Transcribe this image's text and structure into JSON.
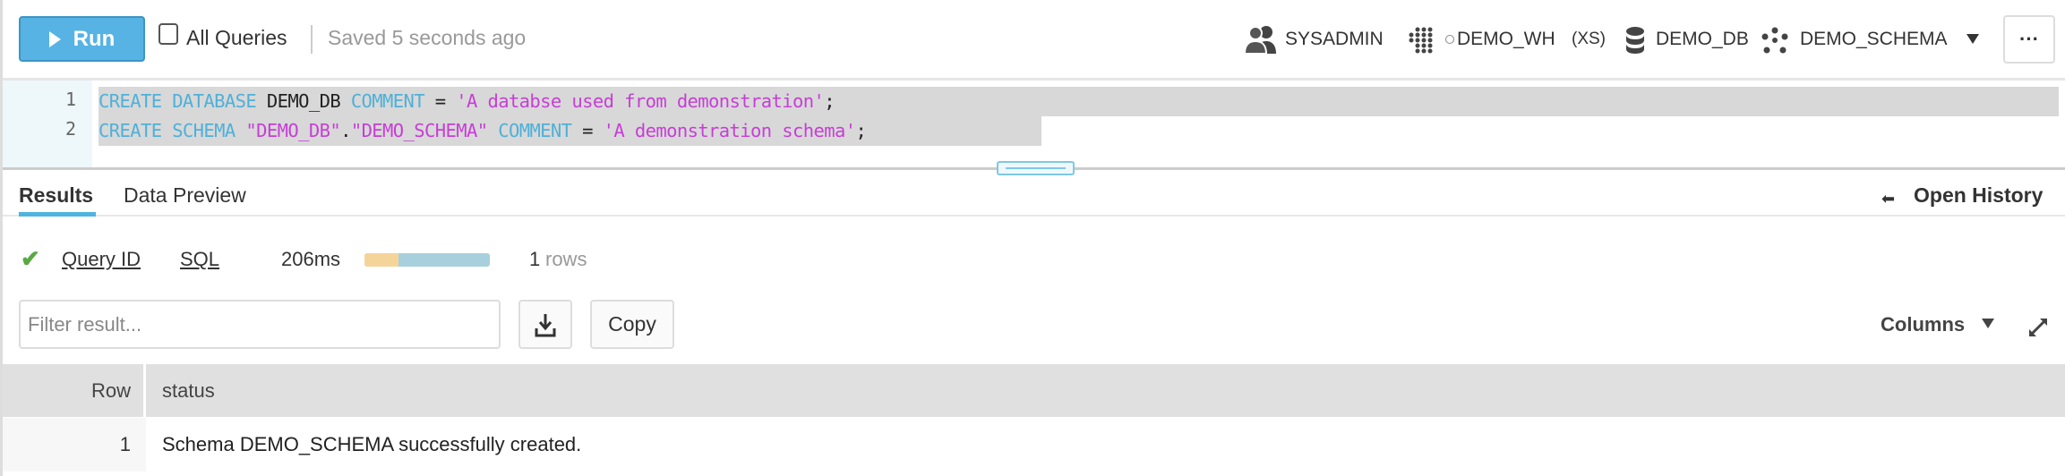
{
  "toolbar": {
    "run_label": "Run",
    "all_queries_label": "All Queries",
    "all_queries_checked": false,
    "saved_text": "Saved 5 seconds ago",
    "role": "SYSADMIN",
    "warehouse": "DEMO_WH",
    "warehouse_size": "(XS)",
    "database": "DEMO_DB",
    "schema": "DEMO_SCHEMA",
    "more_label": "···"
  },
  "editor": {
    "line_numbers": [
      "1",
      "2"
    ],
    "lines": [
      [
        {
          "t": "CREATE DATABASE ",
          "c": "kw"
        },
        {
          "t": "DEMO_DB ",
          "c": "id"
        },
        {
          "t": "COMMENT ",
          "c": "kw"
        },
        {
          "t": "= ",
          "c": "id"
        },
        {
          "t": "'A databse used from demonstration'",
          "c": "str"
        },
        {
          "t": ";",
          "c": "id"
        }
      ],
      [
        {
          "t": "CREATE SCHEMA ",
          "c": "kw"
        },
        {
          "t": "\"DEMO_DB\"",
          "c": "str"
        },
        {
          "t": ".",
          "c": "id"
        },
        {
          "t": "\"DEMO_SCHEMA\" ",
          "c": "str"
        },
        {
          "t": "COMMENT ",
          "c": "kw"
        },
        {
          "t": "= ",
          "c": "id"
        },
        {
          "t": "'A demonstration schema'",
          "c": "str"
        },
        {
          "t": ";",
          "c": "id"
        }
      ]
    ]
  },
  "tabs": [
    {
      "label": "Results",
      "active": true
    },
    {
      "label": "Data Preview",
      "active": false
    }
  ],
  "open_history_label": "Open History",
  "status": {
    "query_id_label": "Query ID",
    "sql_label": "SQL",
    "duration": "206ms",
    "rows_count": "1",
    "rows_label": "rows",
    "progress_compile_fraction": 0.27
  },
  "filter": {
    "placeholder": "Filter result...",
    "value": ""
  },
  "copy_label": "Copy",
  "columns_label": "Columns",
  "table": {
    "headers": [
      "Row",
      "status"
    ],
    "rows": [
      [
        "1",
        "Schema DEMO_SCHEMA successfully created."
      ]
    ]
  },
  "colors": {
    "accent": "#56b3e4",
    "keyword": "#4fb0d8",
    "string": "#c73ed6",
    "success": "#5aa846"
  }
}
